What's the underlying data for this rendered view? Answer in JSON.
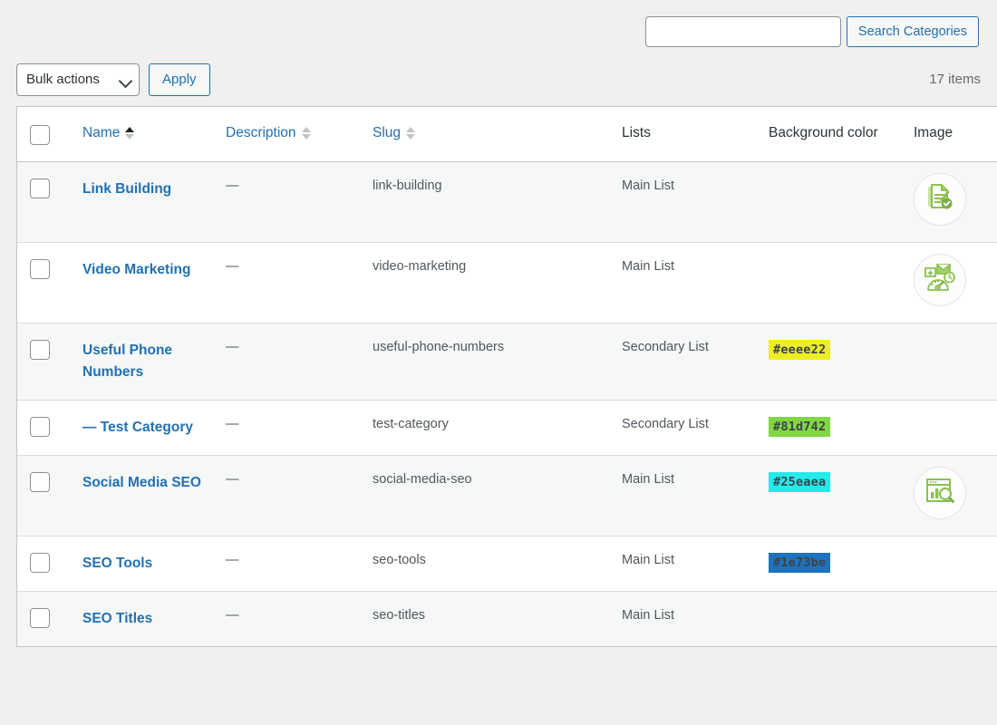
{
  "search": {
    "value": "",
    "placeholder": "",
    "submit_label": "Search Categories"
  },
  "toolbar": {
    "bulk_actions_label": "Bulk actions",
    "apply_label": "Apply",
    "items_count": "17 items"
  },
  "table": {
    "columns": [
      {
        "key": "cb",
        "label": "",
        "sortable": false
      },
      {
        "key": "name",
        "label": "Name",
        "sortable": true,
        "sorted": "asc"
      },
      {
        "key": "desc",
        "label": "Description",
        "sortable": true,
        "sorted": "none"
      },
      {
        "key": "slug",
        "label": "Slug",
        "sortable": true,
        "sorted": "none"
      },
      {
        "key": "lists",
        "label": "Lists",
        "sortable": false
      },
      {
        "key": "bg",
        "label": "Background color",
        "sortable": false
      },
      {
        "key": "img",
        "label": "Image",
        "sortable": false
      }
    ],
    "rows": [
      {
        "name": "Link Building",
        "description": "—",
        "slug": "link-building",
        "lists": "Main List",
        "background_color": "",
        "image_icon": "document-check-icon"
      },
      {
        "name": "Video Marketing",
        "description": "—",
        "slug": "video-marketing",
        "lists": "Main List",
        "background_color": "",
        "image_icon": "email-gauge-icon"
      },
      {
        "name": "Useful Phone Numbers",
        "description": "—",
        "slug": "useful-phone-numbers",
        "lists": "Secondary List",
        "background_color": "#eeee22",
        "image_icon": ""
      },
      {
        "name": "— Test Category",
        "description": "—",
        "slug": "test-category",
        "lists": "Secondary List",
        "background_color": "#81d742",
        "image_icon": ""
      },
      {
        "name": "Social Media SEO",
        "description": "—",
        "slug": "social-media-seo",
        "lists": "Main List",
        "background_color": "#25eaea",
        "image_icon": "chart-search-icon"
      },
      {
        "name": "SEO Tools",
        "description": "—",
        "slug": "seo-tools",
        "lists": "Main List",
        "background_color": "#1e73be",
        "image_icon": ""
      },
      {
        "name": "SEO Titles",
        "description": "—",
        "slug": "seo-titles",
        "lists": "Main List",
        "background_color": "",
        "image_icon": ""
      }
    ]
  },
  "theme": {
    "link_color": "#2271b1",
    "text_color": "#50575e",
    "page_bg": "#f0f0f1",
    "stripe_bg": "#f6f7f7",
    "border_color": "#c3c4c7",
    "icon_green": "#8bc34a"
  }
}
